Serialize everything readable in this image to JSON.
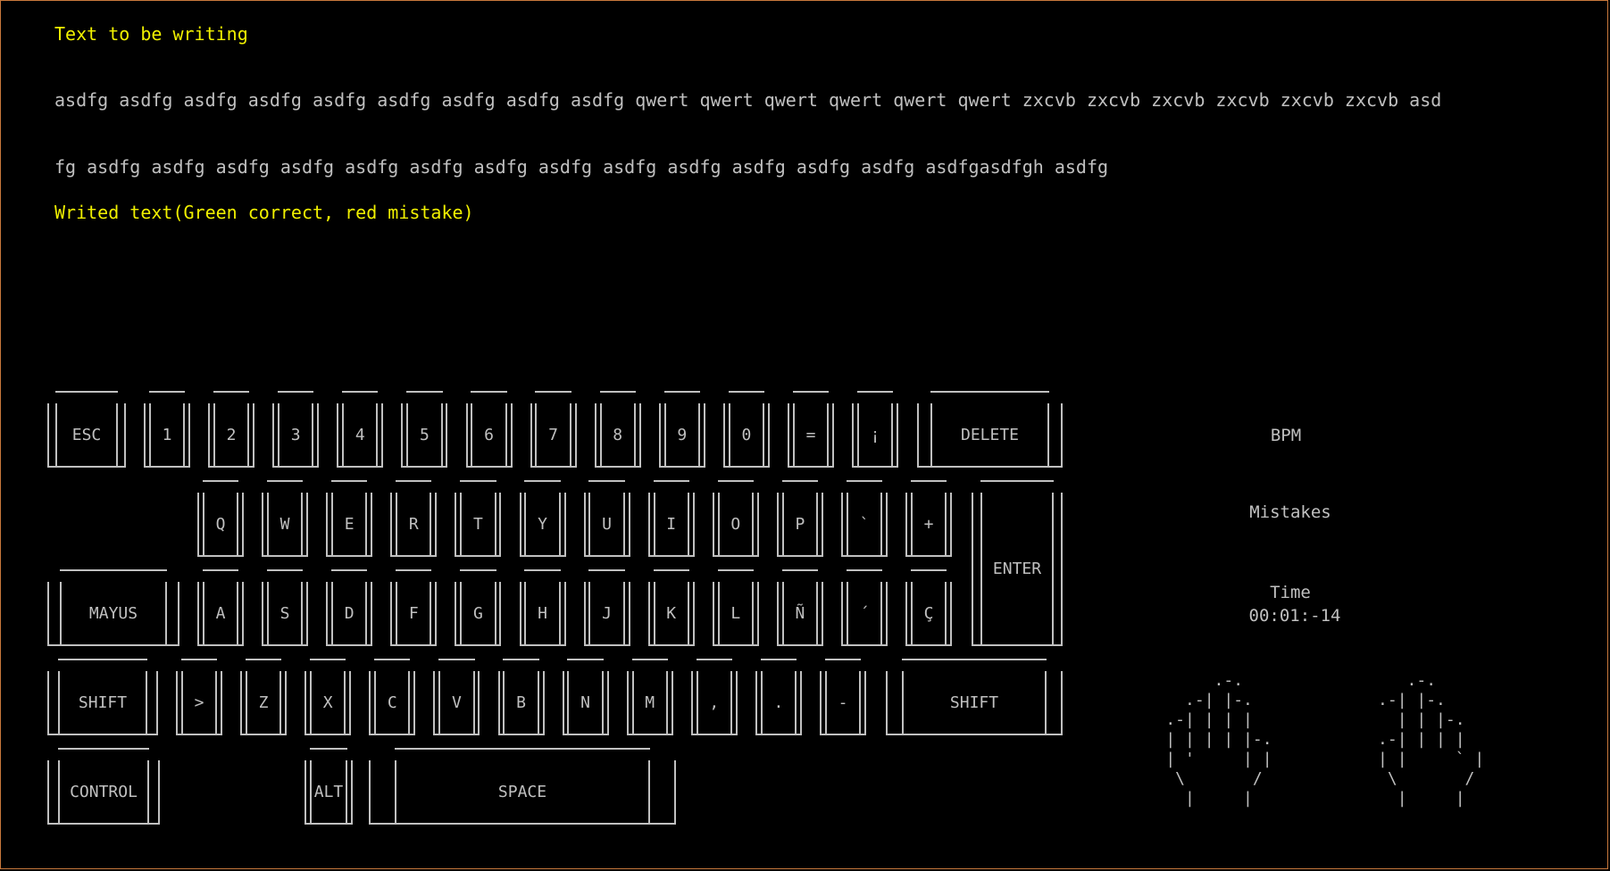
{
  "prompt": {
    "heading": "Text to be writing",
    "lines": [
      "asdfg asdfg asdfg asdfg asdfg asdfg asdfg asdfg asdfg qwert qwert qwert qwert qwert qwert zxcvb zxcvb zxcvb zxcvb zxcvb zxcvb asd",
      "fg asdfg asdfg asdfg asdfg asdfg asdfg asdfg asdfg asdfg asdfg asdfg asdfg asdfg asdfgasdfgh asdfg"
    ]
  },
  "typed": {
    "heading": "Writed text(Green correct, red mistake)",
    "content": ""
  },
  "keyboard": {
    "row1": [
      "ESC",
      "1",
      "2",
      "3",
      "4",
      "5",
      "6",
      "7",
      "8",
      "9",
      "0",
      "=",
      "¡",
      "DELETE"
    ],
    "row2": [
      "Q",
      "W",
      "E",
      "R",
      "T",
      "Y",
      "U",
      "I",
      "O",
      "P",
      "`",
      "+",
      "ENTER"
    ],
    "row3": [
      "MAYUS",
      "A",
      "S",
      "D",
      "F",
      "G",
      "H",
      "J",
      "K",
      "L",
      "Ñ",
      "´",
      "Ç"
    ],
    "row4": [
      "SHIFT",
      ">",
      "Z",
      "X",
      "C",
      "V",
      "B",
      "N",
      "M",
      ",",
      ".",
      "-",
      "SHIFT"
    ],
    "row5": [
      "CONTROL",
      "ALT",
      "SPACE"
    ]
  },
  "stats": {
    "bpm_label": "BPM",
    "bpm_value": "",
    "mistakes_label": "Mistakes",
    "mistakes_value": "",
    "time_label": "Time",
    "time_value": "00:01:-14"
  },
  "hands": {
    "left": "         .-.\n      .-| |-.\n    .-| | | |\n    | | | | |-.\n    | '     | |\n     \\       /\n      |     |",
    "right": "         .-.\n      .-| |-.\n        | | |-.\n      .-| | | |\n      | |     ` |\n       \\       /\n        |     |"
  },
  "colors": {
    "background": "#000000",
    "text": "#c0c0c0",
    "heading": "#f0f000",
    "correct": "#22cc22",
    "mistake": "#ee2222"
  }
}
